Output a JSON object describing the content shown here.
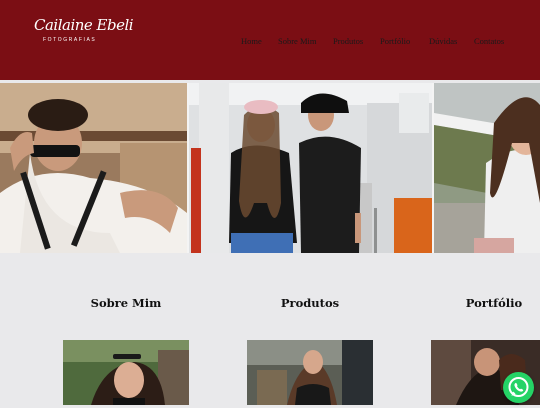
{
  "header": {
    "logo_script": "Cailaine Ebeli",
    "logo_sub": "FOTOGRAFIAS",
    "nav": [
      "Home",
      "Sobre Mim",
      "Produtos",
      "Portfólio",
      "Dúvidas",
      "Contatos"
    ]
  },
  "sections": [
    {
      "title": "Sobre Mim"
    },
    {
      "title": "Produtos"
    },
    {
      "title": "Portfólio"
    }
  ],
  "colors": {
    "brand": "#7b0e14",
    "background": "#e9e9eb",
    "whatsapp": "#25d366"
  },
  "icons": {
    "whatsapp": "whatsapp-icon"
  }
}
